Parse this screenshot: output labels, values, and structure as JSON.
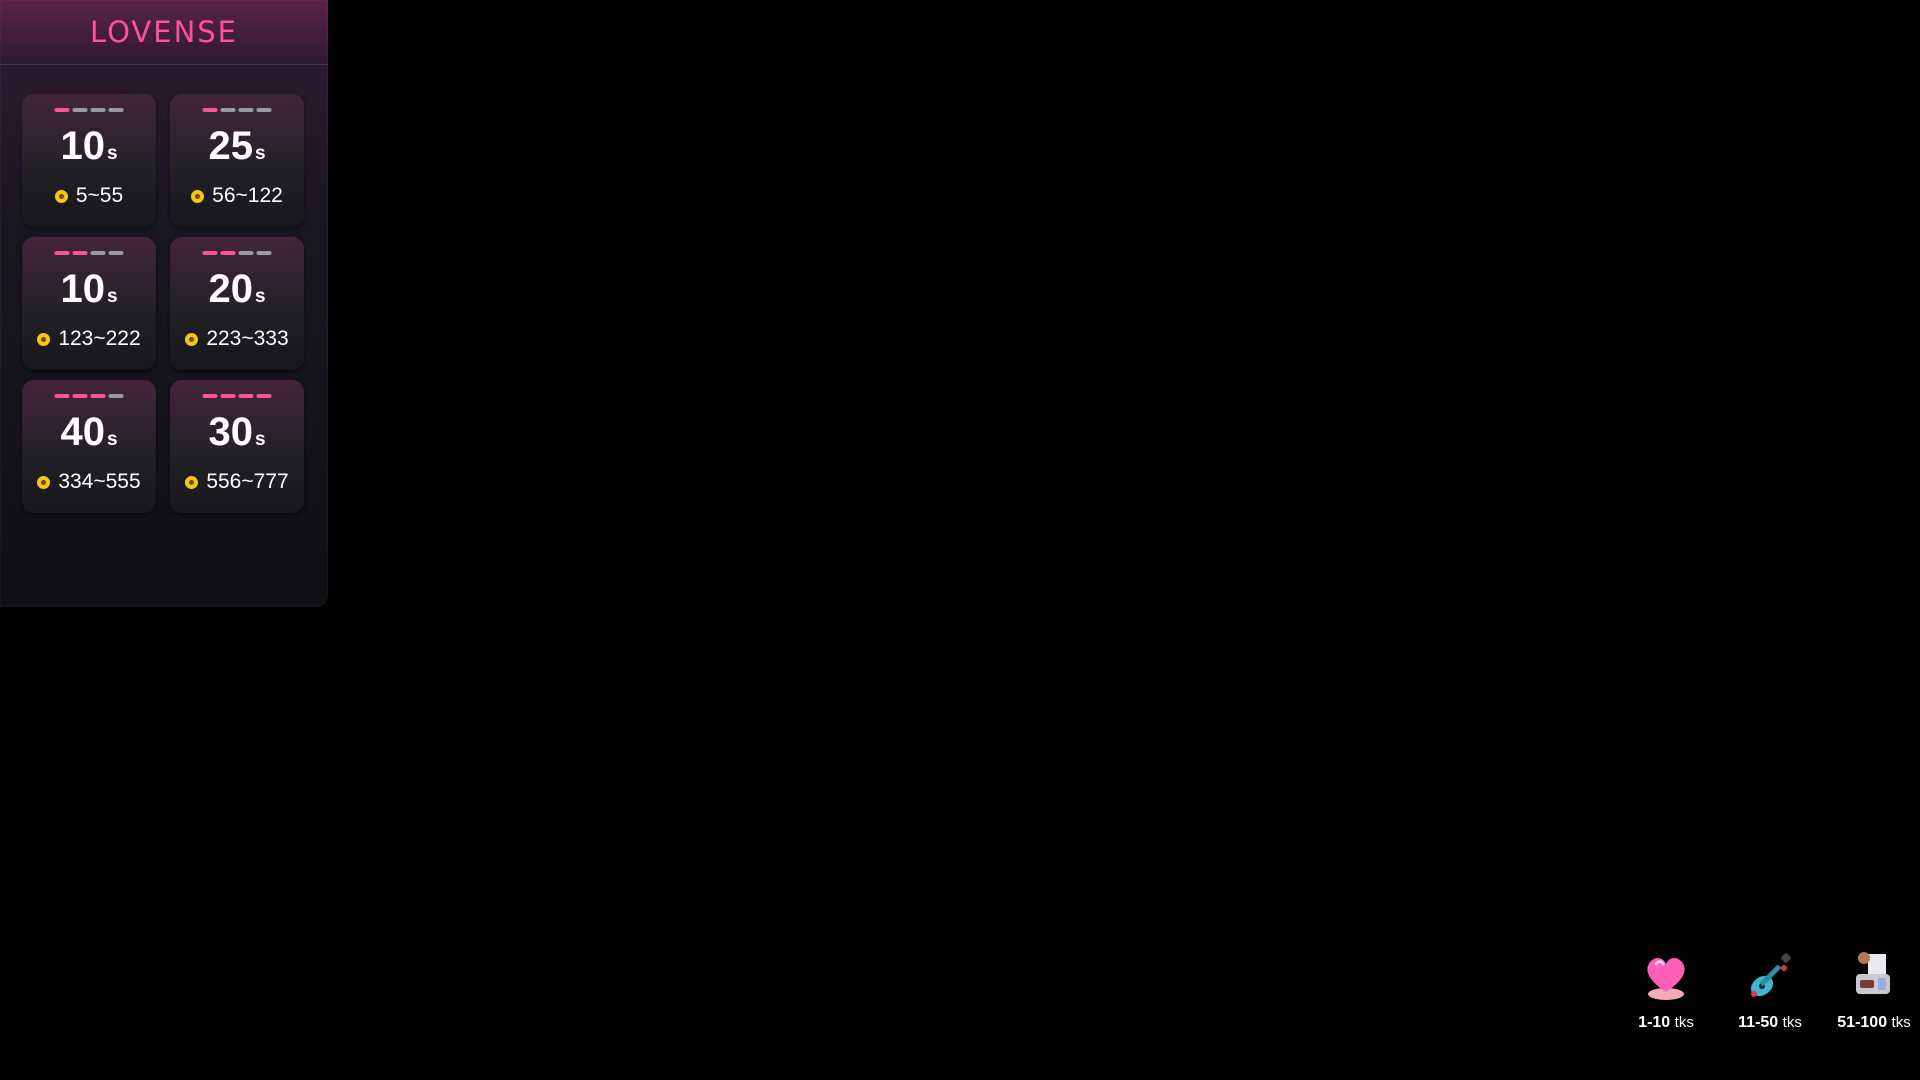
{
  "brand": {
    "logo_text": "LOVENSE",
    "accent": "#ff4fa0"
  },
  "levels": [
    {
      "duration": "10",
      "unit": "s",
      "range": "5~55",
      "level": 1
    },
    {
      "duration": "25",
      "unit": "s",
      "range": "56~122",
      "level": 1
    },
    {
      "duration": "10",
      "unit": "s",
      "range": "123~222",
      "level": 2
    },
    {
      "duration": "20",
      "unit": "s",
      "range": "223~333",
      "level": 2
    },
    {
      "duration": "40",
      "unit": "s",
      "range": "334~555",
      "level": 3
    },
    {
      "duration": "30",
      "unit": "s",
      "range": "556~777",
      "level": 4
    }
  ],
  "tip_menu": [
    {
      "icon": "heart-icon",
      "amount": "1-10",
      "unit": "tks"
    },
    {
      "icon": "guitar-icon",
      "amount": "11-50",
      "unit": "tks"
    },
    {
      "icon": "typewriter-icon",
      "amount": "51-100",
      "unit": "tks"
    }
  ]
}
